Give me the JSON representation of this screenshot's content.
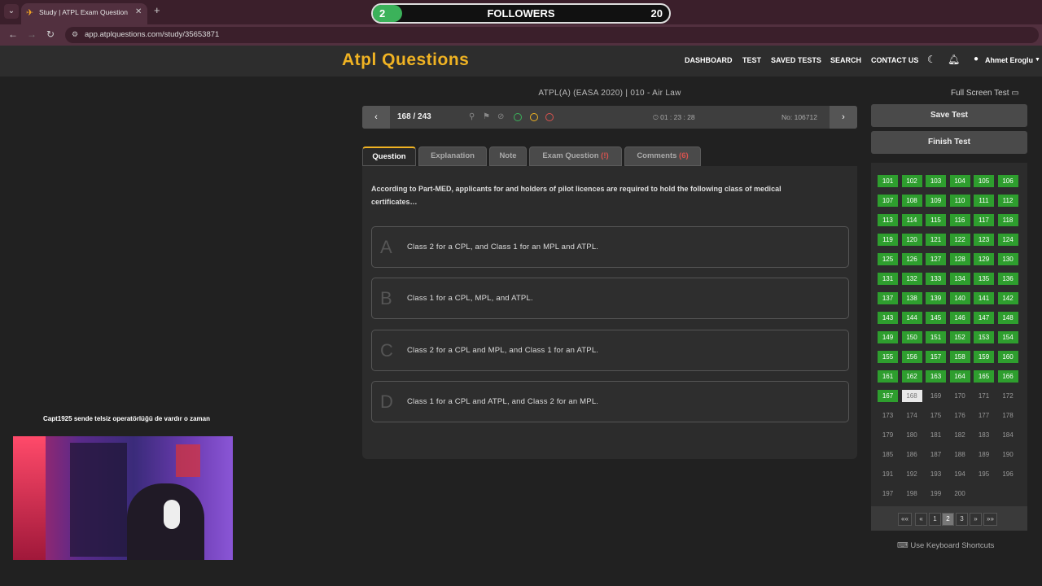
{
  "browser": {
    "tab_title": "Study | ATPL Exam Question Bank",
    "favicon": "plane-icon",
    "url": "app.atplquestions.com/study/35653871"
  },
  "followers": {
    "current": "2",
    "label": "FOLLOWERS",
    "goal": "20",
    "progress": 0.1,
    "accent": "#3bb25a"
  },
  "site": {
    "logo": "Atpl Questions",
    "nav": [
      "DASHBOARD",
      "TEST",
      "SAVED TESTS",
      "SEARCH",
      "CONTACT US"
    ],
    "user": "Ahmet Eroglu",
    "brand_color": "#f0b323"
  },
  "test": {
    "title": "ATPL(A) (EASA 2020) | 010 - Air Law",
    "full_screen": "Full Screen Test",
    "counter": "168 / 243",
    "timer": "01 : 23 : 28",
    "question_no": "No: 106712"
  },
  "tabs": {
    "question": "Question",
    "explanation": "Explanation",
    "note": "Note",
    "exam_question": "Exam Question",
    "exam_question_count": "(!)",
    "comments": "Comments",
    "comments_count": "(6)"
  },
  "question": {
    "text": "According to Part-MED, applicants for and holders of pilot licences are required to hold the following class of medical certificates…",
    "answers": [
      {
        "letter": "A",
        "text": "Class 2 for a CPL, and Class 1 for an MPL and ATPL."
      },
      {
        "letter": "B",
        "text": "Class 1 for a CPL, MPL, and ATPL."
      },
      {
        "letter": "C",
        "text": "Class 2 for a CPL and MPL, and Class 1 for an ATPL."
      },
      {
        "letter": "D",
        "text": "Class 1 for a CPL and ATPL, and Class 2 for an MPL."
      }
    ]
  },
  "side": {
    "save": "Save Test",
    "finish": "Finish Test",
    "current_question": 168,
    "first_number": 101,
    "last_number": 200,
    "pager": [
      "««",
      "«",
      "1",
      "2",
      "3",
      "»",
      "»»"
    ],
    "pager_active": "2",
    "keyboard": "Use Keyboard Shortcuts"
  },
  "stream": {
    "chat_user": "Capt1925",
    "chat_message": "sende telsiz operatörlüğü de vardır o zaman"
  }
}
